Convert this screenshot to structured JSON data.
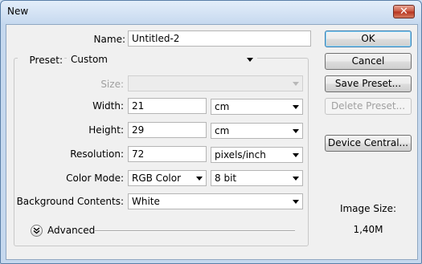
{
  "window": {
    "title": "New",
    "close_glyph": "✕"
  },
  "form": {
    "name_label": "Name:",
    "name_value": "Untitled-2",
    "preset_label": "Preset:",
    "preset_value": "Custom",
    "size_label": "Size:",
    "size_value": "",
    "width_label": "Width:",
    "width_value": "21",
    "width_unit": "cm",
    "height_label": "Height:",
    "height_value": "29",
    "height_unit": "cm",
    "resolution_label": "Resolution:",
    "resolution_value": "72",
    "resolution_unit": "pixels/inch",
    "color_mode_label": "Color Mode:",
    "color_mode_value": "RGB Color",
    "bit_depth_value": "8 bit",
    "background_label": "Background Contents:",
    "background_value": "White",
    "advanced_label": "Advanced"
  },
  "buttons": {
    "ok": "OK",
    "cancel": "Cancel",
    "save_preset": "Save Preset...",
    "delete_preset": "Delete Preset...",
    "device_central": "Device Central..."
  },
  "info": {
    "image_size_label": "Image Size:",
    "image_size_value": "1,40M"
  },
  "icons": {
    "close": "close-icon",
    "dropdown": "chevron-down-icon",
    "advanced": "double-chevron-down-icon"
  },
  "colors": {
    "title_bar": "#c9dbf0",
    "close_button": "#c8553e",
    "default_button_border": "#3c7fb1"
  }
}
